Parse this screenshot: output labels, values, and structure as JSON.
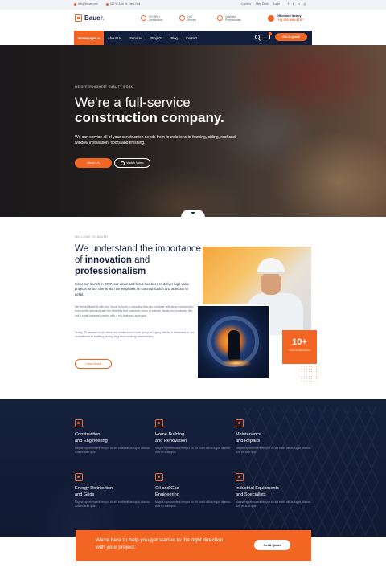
{
  "topbar": {
    "email": "info@bauer.com",
    "address": "312 W 34th St, New York",
    "links": [
      "Careers",
      "Help Desk",
      "Login"
    ],
    "social_icons": [
      "facebook-icon",
      "twitter-icon",
      "linkedin-icon",
      "instagram-icon"
    ]
  },
  "brand": {
    "name": "Bauer",
    "dot": "."
  },
  "header_info": [
    {
      "line1": "ISO 9001",
      "line2": "Certification",
      "icon": "certificate-icon"
    },
    {
      "line1": "24/7",
      "line2": "Service",
      "icon": "clock-icon"
    },
    {
      "line1": "Qualified",
      "line2": "Professionals",
      "icon": "user-icon"
    }
  ],
  "office": {
    "title": "Office and factory",
    "phone": "(+1) 201 890-3797"
  },
  "nav": {
    "items": [
      "Homepages",
      "About Us",
      "Services",
      "Projects",
      "Blog",
      "Contact"
    ],
    "quote_label": "Get A Quote"
  },
  "hero": {
    "kicker": "WE OFFER HIGHEST QUALITY WORK",
    "title_line1": "We're a full-service",
    "title_line2": "construction company.",
    "description": "We can service all of your construction needs from foundations to framing, siding, roof and window installation, floors and finishing.",
    "about_label": "About Us",
    "video_label": "Watch Video"
  },
  "about": {
    "kicker": "WELCOME TO BAUER",
    "heading_a": "We understand the importance of ",
    "heading_b": "innovation",
    "heading_c": " and ",
    "heading_d": "professionalism",
    "p1": "Since our launch in 2007, our vision and focus has been to deliver high value projects for our clients with the emphasis on communication and attention to detail.",
    "p2": "We began Bauer 8 with one focus: to build a company that can compete with large construction firms while operating with the flexibility and customer focus of a small, family-run business. We call it small business values with a big business approach.",
    "p3": "Today, 75 percent of our business comes from a core group of legacy clients, a testament to our commitment to building strong, long-term working relationships.",
    "learn_label": "Learn More",
    "badge_number": "10+",
    "badge_label": "Years of Experience"
  },
  "services": [
    {
      "title_a": "Construction",
      "title_b": "and Engineering",
      "desc": "Magna reprehenderit tempor do elit mollit officia fugiat ullamco duis ex aute quis.",
      "icon": "construction-icon"
    },
    {
      "title_a": "Home Building",
      "title_b": "and Renovation",
      "desc": "Magna reprehenderit tempor do elit mollit officia fugiat ullamco duis ex aute quis.",
      "icon": "building-icon"
    },
    {
      "title_a": "Maintenance",
      "title_b": "and Repairs",
      "desc": "Magna reprehenderit tempor do elit mollit officia fugiat ullamco duis ex aute quis.",
      "icon": "repair-icon"
    },
    {
      "title_a": "Energy Distribution",
      "title_b": "and Grids",
      "desc": "Magna reprehenderit tempor do elit mollit officia fugiat ullamco duis ex aute quis.",
      "icon": "energy-icon"
    },
    {
      "title_a": "Oil and Gas",
      "title_b": "Engineering",
      "desc": "Magna reprehenderit tempor do elit mollit officia fugiat ullamco duis ex aute quis.",
      "icon": "oil-gas-icon"
    },
    {
      "title_a": "Industrial Equipments",
      "title_b": "and Specialists",
      "desc": "Magna reprehenderit tempor do elit mollit officia fugiat ullamco duis ex aute quis.",
      "icon": "industrial-icon"
    }
  ],
  "cta": {
    "text": "We're here to help you get started in the right direction with your project.",
    "button_label": "Get A Quote"
  },
  "colors": {
    "accent": "#f26522",
    "navy": "#14203b",
    "services_bg": "#15203d"
  }
}
